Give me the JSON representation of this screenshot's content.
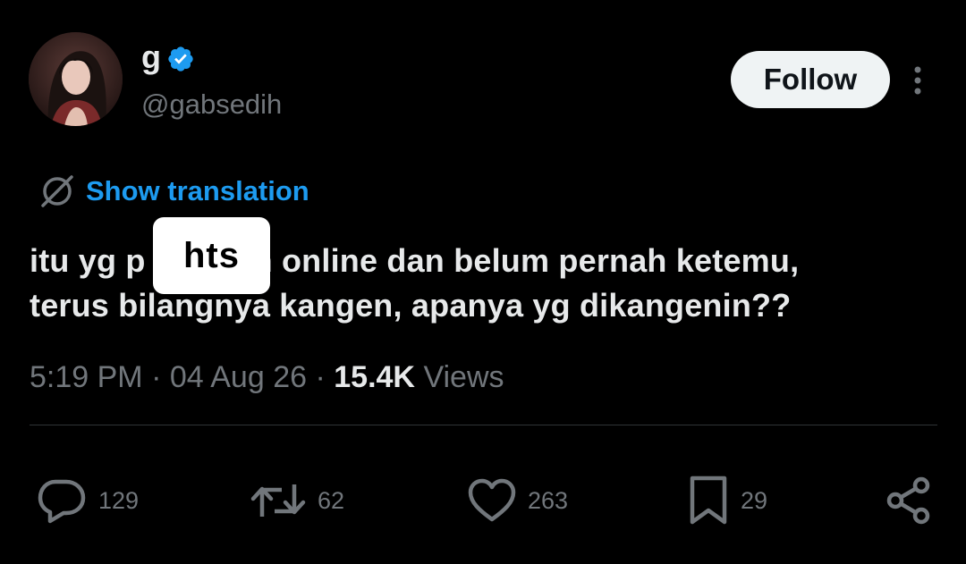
{
  "author": {
    "display_name": "g",
    "handle": "@gabsedih",
    "verified": true,
    "avatar_icon": "profile-photo"
  },
  "header": {
    "follow_label": "Follow",
    "more_icon": "vertical-ellipsis-icon"
  },
  "translation": {
    "label": "Show translation",
    "icon": "globe-icon"
  },
  "tweet": {
    "line1": "itu yg p",
    "line1_rest": "n online dan belum pernah ketemu,",
    "line2": "terus bilangnya kangen, apanya yg dikangenin??",
    "sticker_text": "hts"
  },
  "meta": {
    "time": "5:19 PM",
    "separator": "·",
    "date": "04 Aug 26",
    "views_count": "15.4K",
    "views_label": "Views"
  },
  "actions": {
    "reply_count": "129",
    "retweet_count": "62",
    "like_count": "263",
    "bookmark_count": "29"
  },
  "colors": {
    "background": "#000000",
    "text_primary": "#e7e9ea",
    "text_secondary": "#71767b",
    "accent_blue": "#1d9bf0",
    "divider": "#2f3336",
    "follow_bg": "#eff3f4"
  }
}
